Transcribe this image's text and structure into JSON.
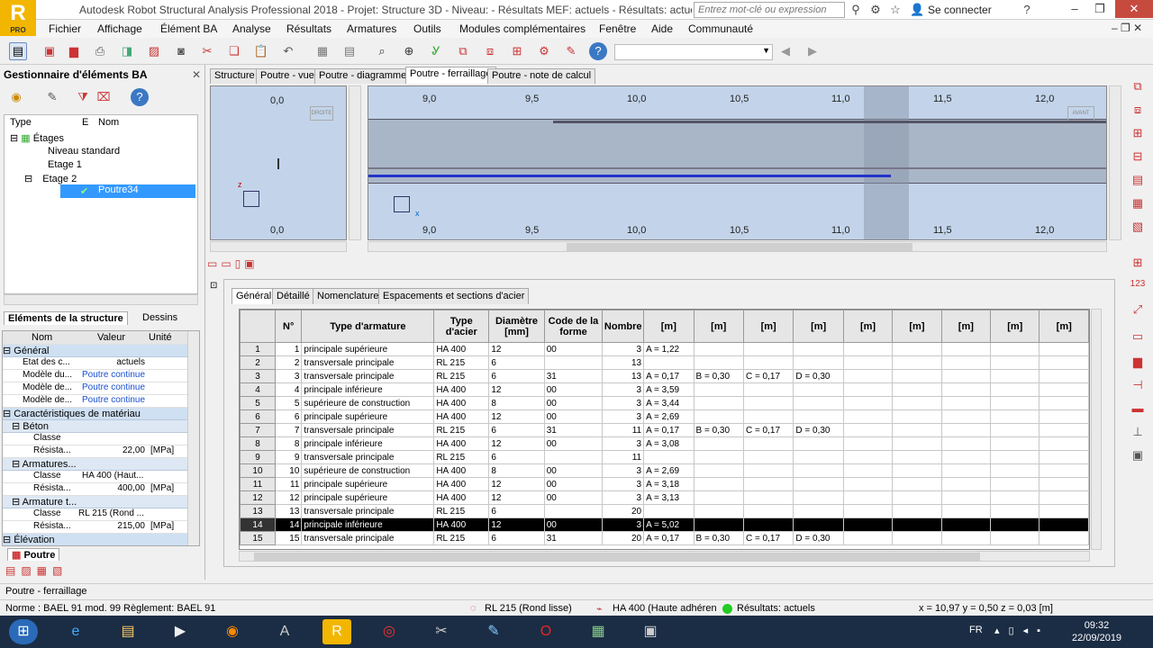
{
  "app": {
    "title": "Autodesk Robot Structural Analysis Professional 2018 - Projet: Structure 3D - Niveau:  - Résultats MEF: actuels - Résultats: actuels",
    "logo_letter": "R",
    "logo_sub": "PRO",
    "search_placeholder": "Entrez mot-clé ou expression",
    "login": "Se connecter"
  },
  "menu": [
    "Fichier",
    "Affichage",
    "Élément BA",
    "Analyse",
    "Résultats",
    "Armatures",
    "Outils",
    "Modules complémentaires",
    "Fenêtre",
    "Aide",
    "Communauté"
  ],
  "left": {
    "title": "Gestionnaire d'éléments BA",
    "tree_headers": {
      "type": "Type",
      "e": "E",
      "name": "Nom"
    },
    "tree": [
      {
        "label": "Étages",
        "level": 0
      },
      {
        "label": "Niveau standard",
        "level": 1
      },
      {
        "label": "Etage 1",
        "level": 1
      },
      {
        "label": "Etage 2",
        "level": 1
      },
      {
        "label": "Poutre34",
        "level": 2
      }
    ],
    "tabs": [
      "Eléments de la structure",
      "Dessins"
    ],
    "prop_headers": {
      "name": "Nom",
      "value": "Valeur",
      "unit": "Unité"
    },
    "prop_sections": {
      "general": "Général",
      "materials": "Caractéristiques de matériau",
      "beton": "Béton",
      "armatures": "Armatures...",
      "armature_t": "Armature t...",
      "elevation": "Élévation"
    },
    "props": [
      {
        "n": "Etat des c...",
        "v": "actuels",
        "u": ""
      },
      {
        "n": "Modèle du...",
        "v": "Poutre continue",
        "u": ""
      },
      {
        "n": "Modèle de...",
        "v": "Poutre continue",
        "u": ""
      },
      {
        "n": "Modèle de...",
        "v": "Poutre continue",
        "u": ""
      }
    ],
    "beton": [
      {
        "n": "Classe",
        "v": "",
        "u": ""
      },
      {
        "n": "Résista...",
        "v": "22,00",
        "u": "[MPa]"
      }
    ],
    "arm": [
      {
        "n": "Classe",
        "v": "HA 400 (Haut...",
        "u": ""
      },
      {
        "n": "Résista...",
        "v": "400,00",
        "u": "[MPa]"
      }
    ],
    "armt": [
      {
        "n": "Classe",
        "v": "RL 215 (Rond ...",
        "u": ""
      },
      {
        "n": "Résista...",
        "v": "215,00",
        "u": "[MPa]"
      }
    ],
    "bottom_tab": "Poutre"
  },
  "view_tabs": [
    "Structure",
    "Poutre - vue",
    "Poutre - diagrammes",
    "Poutre - ferraillage",
    "Poutre - note de calcul"
  ],
  "view": {
    "left_ticks": [
      "0,0",
      "0,0"
    ],
    "x_ticks": [
      "9,0",
      "9,5",
      "10,0",
      "10,5",
      "11,0",
      "11,5",
      "12,0"
    ],
    "side_label_left": "DROITE",
    "side_label_right": "AVANT",
    "zero": "0,0"
  },
  "bottom_tabs": [
    "Général",
    "Détaillé",
    "Nomenclature",
    "Espacements et sections d'acier"
  ],
  "grid": {
    "headers": [
      "N°",
      "Type d'armature",
      "Type d'acier",
      "Diamètre [mm]",
      "Code de la forme",
      "Nombre",
      "[m]",
      "[m]",
      "[m]",
      "[m]",
      "[m]",
      "[m]",
      "[m]",
      "[m]",
      "[m]"
    ],
    "rows": [
      [
        "1",
        "1",
        "principale supérieure",
        "HA 400",
        "12",
        "00",
        "3",
        "A = 1,22",
        "",
        "",
        ""
      ],
      [
        "2",
        "2",
        "transversale principale",
        "RL 215",
        "6",
        "",
        "13",
        "",
        "",
        "",
        ""
      ],
      [
        "3",
        "3",
        "transversale principale",
        "RL 215",
        "6",
        "31",
        "13",
        "A = 0,17",
        "B = 0,30",
        "C = 0,17",
        "D = 0,30"
      ],
      [
        "4",
        "4",
        "principale inférieure",
        "HA 400",
        "12",
        "00",
        "3",
        "A = 3,59",
        "",
        "",
        ""
      ],
      [
        "5",
        "5",
        "supérieure de construction",
        "HA 400",
        "8",
        "00",
        "3",
        "A = 3,44",
        "",
        "",
        ""
      ],
      [
        "6",
        "6",
        "principale supérieure",
        "HA 400",
        "12",
        "00",
        "3",
        "A = 2,69",
        "",
        "",
        ""
      ],
      [
        "7",
        "7",
        "transversale principale",
        "RL 215",
        "6",
        "31",
        "11",
        "A = 0,17",
        "B = 0,30",
        "C = 0,17",
        "D = 0,30"
      ],
      [
        "8",
        "8",
        "principale inférieure",
        "HA 400",
        "12",
        "00",
        "3",
        "A = 3,08",
        "",
        "",
        ""
      ],
      [
        "9",
        "9",
        "transversale principale",
        "RL 215",
        "6",
        "",
        "11",
        "",
        "",
        "",
        ""
      ],
      [
        "10",
        "10",
        "supérieure de construction",
        "HA 400",
        "8",
        "00",
        "3",
        "A = 2,69",
        "",
        "",
        ""
      ],
      [
        "11",
        "11",
        "principale supérieure",
        "HA 400",
        "12",
        "00",
        "3",
        "A = 3,18",
        "",
        "",
        ""
      ],
      [
        "12",
        "12",
        "principale supérieure",
        "HA 400",
        "12",
        "00",
        "3",
        "A = 3,13",
        "",
        "",
        ""
      ],
      [
        "13",
        "13",
        "transversale principale",
        "RL 215",
        "6",
        "",
        "20",
        "",
        "",
        "",
        ""
      ],
      [
        "14",
        "14",
        "principale inférieure",
        "HA 400",
        "12",
        "00",
        "3",
        "A = 5,02",
        "",
        "",
        ""
      ],
      [
        "15",
        "15",
        "transversale principale",
        "RL 215",
        "6",
        "31",
        "20",
        "A = 0,17",
        "B = 0,30",
        "C = 0,17",
        "D = 0,30"
      ]
    ],
    "selected_row": 14
  },
  "status": {
    "view_name": "Poutre - ferraillage",
    "norme": "Norme : BAEL 91 mod. 99  Règlement: BAEL 91",
    "rl": "RL 215 (Rond lisse)",
    "ha": "HA 400 (Haute adhéren",
    "results": "Résultats: actuels",
    "coords": "x = 10,97 y = 0,50 z = 0,03  [m]"
  },
  "taskbar": {
    "lang": "FR",
    "time": "09:32",
    "date": "22/09/2019"
  },
  "colors": {
    "accent": "#3399ff",
    "view_bg": "#c3d4ea",
    "selection": "#000000",
    "logo": "#f2b600"
  }
}
